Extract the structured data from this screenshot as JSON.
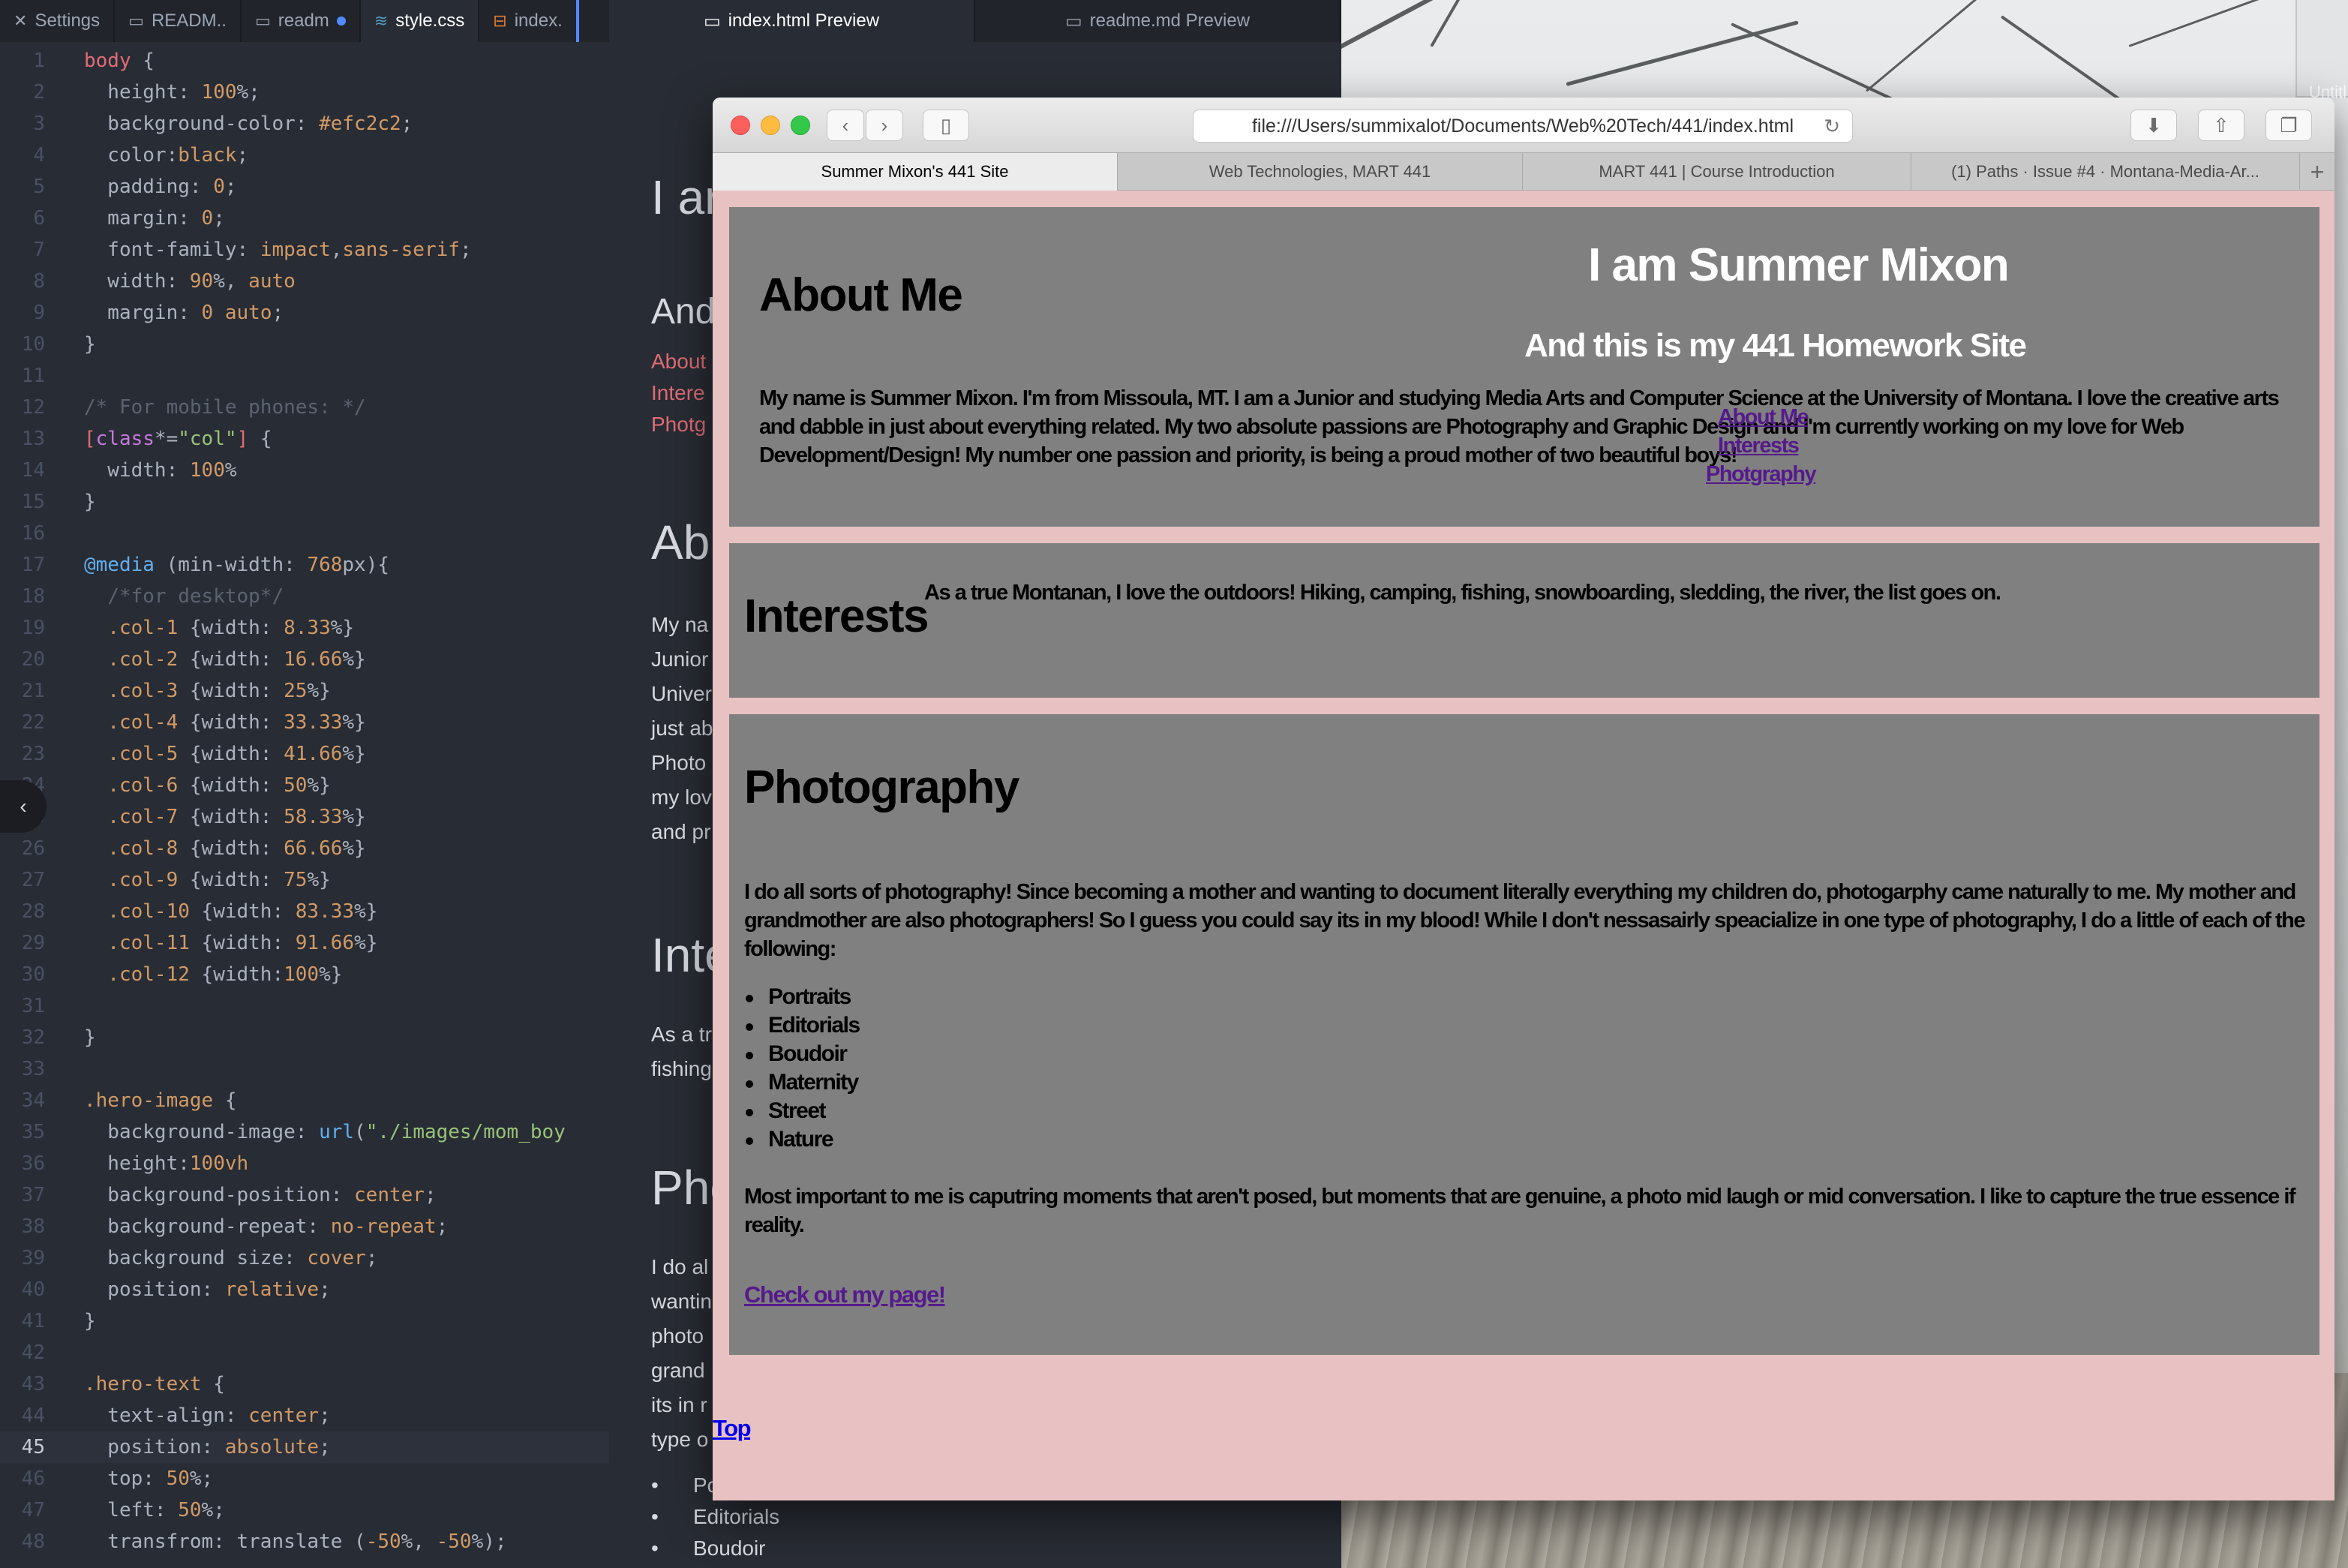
{
  "editor": {
    "tabs": [
      {
        "label": "Settings",
        "icon": "wrench-icon"
      },
      {
        "label": "READM..",
        "icon": "book-icon"
      },
      {
        "label": "readm",
        "icon": "book-icon",
        "modified": true
      },
      {
        "label": "style.css",
        "icon": "css-icon",
        "active": true
      },
      {
        "label": "index.",
        "icon": "html-icon"
      }
    ],
    "current_line": 45
  },
  "preview_tabs": [
    {
      "label": "index.html Preview",
      "active": true
    },
    {
      "label": "readme.md Preview",
      "active": false
    }
  ],
  "preview_content": {
    "heading": "I ar",
    "subheading": "And",
    "links": [
      "About",
      "Intere",
      "Photg"
    ],
    "about_heading": "Ab",
    "about_lines": [
      "My na",
      "Junior",
      "Univer",
      "just ab",
      "Photo",
      "my lov",
      "and pr"
    ],
    "interests_heading": "Inte",
    "interests_lines": [
      "As a tr",
      "fishing"
    ],
    "photo_heading": "Pho",
    "photo_lines": [
      "I do al",
      "wantin",
      "photo",
      "grand",
      "its in r",
      "type o"
    ],
    "list": [
      "Po",
      "Editorials",
      "Boudoir"
    ]
  },
  "browser": {
    "url": "file:///Users/summixalot/Documents/Web%20Tech/441/index.html",
    "tabs": [
      {
        "label": "Summer Mixon's 441 Site",
        "active": true
      },
      {
        "label": "Web Technologies, MART 441",
        "active": false
      },
      {
        "label": "MART 441 | Course Introduction",
        "active": false
      },
      {
        "label": "(1) Paths · Issue #4 · Montana-Media-Ar...",
        "active": false
      }
    ],
    "new_tab": "+"
  },
  "site": {
    "hero_title": "I am Summer Mixon",
    "hero_subtitle": "And this is my 441 Homework Site",
    "nav": [
      "About Me",
      "Interests",
      "Photgraphy"
    ],
    "about_heading": "About Me",
    "about_text": "My name is Summer Mixon. I'm from Missoula, MT. I am a Junior and studying Media Arts and Computer Science at the University of Montana. I love the creative arts and dabble in just about everything related. My two absolute passions are Photography and Graphic Design and I'm currently working on my love for Web Development/Design! My number one passion and priority, is being a proud mother of two beautiful boys!",
    "interests_heading": "Interests",
    "interests_text": "As a true Montanan, I love the outdoors! Hiking, camping, fishing, snowboarding, sledding, the river, the list goes on.",
    "photo_heading": "Photography",
    "photo_text": "I do all sorts of photography! Since becoming a mother and wanting to document literally everything my children do, photogarphy came naturally to me. My mother and grandmother are also photographers! So I guess you could say its in my blood! While I don't nessasairly speacialize in one type of photography, I do a little of each of the following:",
    "photo_list": [
      "Portraits",
      "Editorials",
      "Boudoir",
      "Maternity",
      "Street",
      "Nature"
    ],
    "photo_text2": "Most important to me is caputring moments that aren't posed, but moments that are genuine, a photo mid laugh or mid conversation. I like to capture the true essence if reality.",
    "cta": "Check out my page!",
    "top_link": "Top",
    "colors": {
      "page_bg": "#efc2c2",
      "section_bg": "#808080",
      "link_visited": "#551a8b",
      "link": "#0000ee"
    }
  },
  "desktop": {
    "untitled_label": "Untitl"
  }
}
